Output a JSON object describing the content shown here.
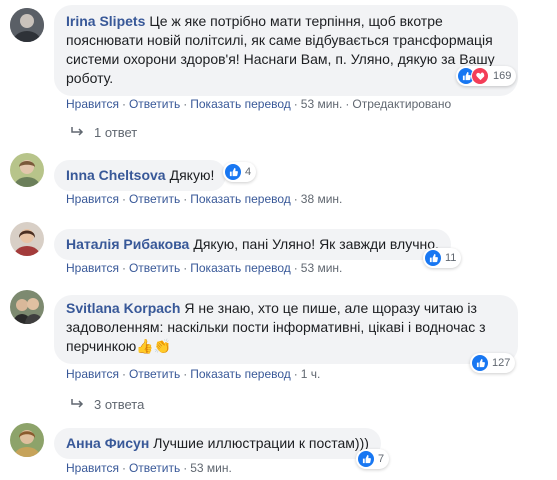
{
  "comments": [
    {
      "author": "Irina Slipets",
      "text": "Це ж яке потрібно мати терпіння, щоб вкотре пояснювати новій політсилі, як саме відбувається трансформація системи охорони здоров'я! Наснаги Вам, п. Уляно, дякую за Вашу роботу.",
      "reactions": "169",
      "time": "53 мин.",
      "edited": "Отредактировано",
      "replies": "1 ответ"
    },
    {
      "author": "Inna Cheltsova",
      "text": "Дякую!",
      "reactions": "4",
      "time": "38 мин."
    },
    {
      "author": "Наталія Рибакова",
      "text": "Дякую, пані Уляно! Як завжди влучно.",
      "reactions": "11",
      "time": "53 мин."
    },
    {
      "author": "Svitlana Korpach",
      "text": "Я не знаю, хто це пише, але щоразу читаю із задоволенням: наскільки пости інформативні, цікаві і водночас з перчинкою",
      "emoji": "👍👏",
      "reactions": "127",
      "time": "1 ч.",
      "replies": "3 ответа"
    },
    {
      "author": "Анна Фисун",
      "text": "Лучшие иллюстрации к постам)))",
      "reactions": "7",
      "time": "53 мин."
    }
  ],
  "actions": {
    "like": "Нравится",
    "reply": "Ответить",
    "translate": "Показать перевод",
    "sep": "·"
  },
  "colors": {
    "link": "#385898",
    "like": "#1877f2",
    "love": "#f33e58",
    "bubble": "#f2f3f5"
  }
}
